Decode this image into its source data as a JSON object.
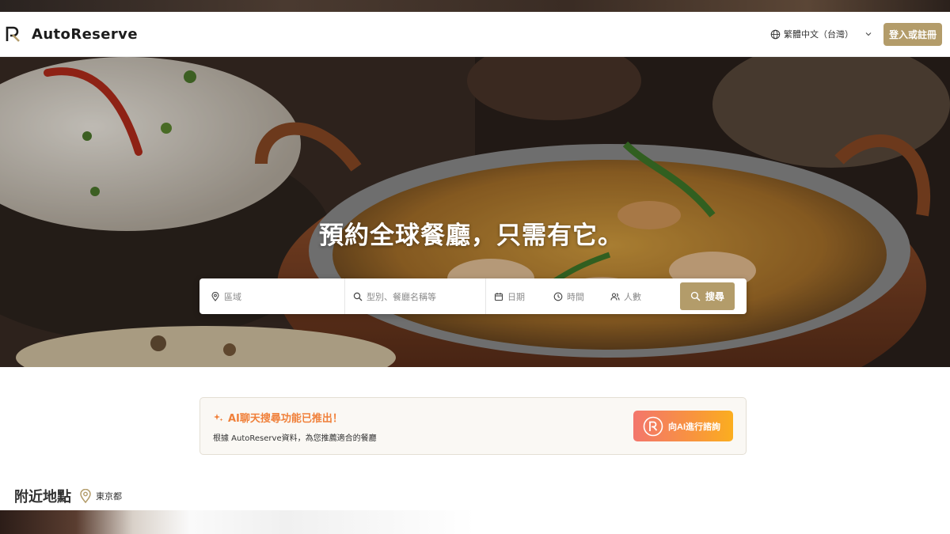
{
  "header": {
    "brand": "AutoReserve",
    "language_label": "繁體中文（台灣）",
    "login_label": "登入或註冊"
  },
  "hero": {
    "headline": "預約全球餐廳，只需有它。"
  },
  "search": {
    "area_placeholder": "區域",
    "genre_placeholder": "型別、餐廳名稱等",
    "date_placeholder": "日期",
    "time_placeholder": "時間",
    "people_placeholder": "人數",
    "search_label": "搜尋"
  },
  "ai_banner": {
    "title": "AI聊天搜尋功能已推出！",
    "subtitle": "根據 AutoReserve資料，為您推薦適合的餐廳",
    "button_label": "向AI進行諮詢"
  },
  "nearby": {
    "title": "附近地點",
    "location": "東京都"
  },
  "colors": {
    "accent": "#b39c6a",
    "ai_title": "#f0803a",
    "ai_button_start": "#f3766c",
    "ai_button_end": "#fbae1f"
  },
  "icons": [
    "globe-icon",
    "chevron-down-icon",
    "location-pin-icon",
    "search-icon",
    "calendar-icon",
    "clock-icon",
    "people-icon",
    "sparkle-icon",
    "ai-logo-icon"
  ]
}
